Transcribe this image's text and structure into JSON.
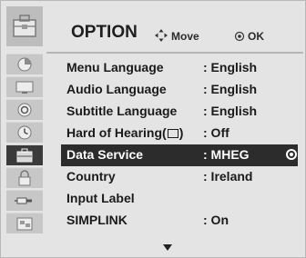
{
  "header": {
    "title": "OPTION",
    "move_hint": "Move",
    "ok_hint": "OK",
    "icon": "option-briefcase-icon"
  },
  "sidebar": {
    "icons": [
      "setup-icon",
      "picture-icon",
      "audio-icon",
      "time-icon",
      "option-icon",
      "lock-icon",
      "input-icon",
      "usb-icon"
    ],
    "active_index": 4
  },
  "menu": {
    "items": [
      {
        "label": "Menu Language",
        "value": ": English"
      },
      {
        "label": "Audio Language",
        "value": ": English"
      },
      {
        "label": "Subtitle Language",
        "value": ": English"
      },
      {
        "label": "Hard of Hearing(",
        "label_suffix": ")",
        "value": ": Off"
      },
      {
        "label": "Data Service",
        "value": ": MHEG",
        "selected": true
      },
      {
        "label": "Country",
        "value": ": Ireland"
      },
      {
        "label": "Input Label",
        "value": ""
      },
      {
        "label": "SIMPLINK",
        "value": ": On"
      }
    ]
  },
  "colors": {
    "panel_bg": "#e4e4e4",
    "selected_bg": "#2c2c2c",
    "sidebar_bg": "#c7c7c7"
  }
}
